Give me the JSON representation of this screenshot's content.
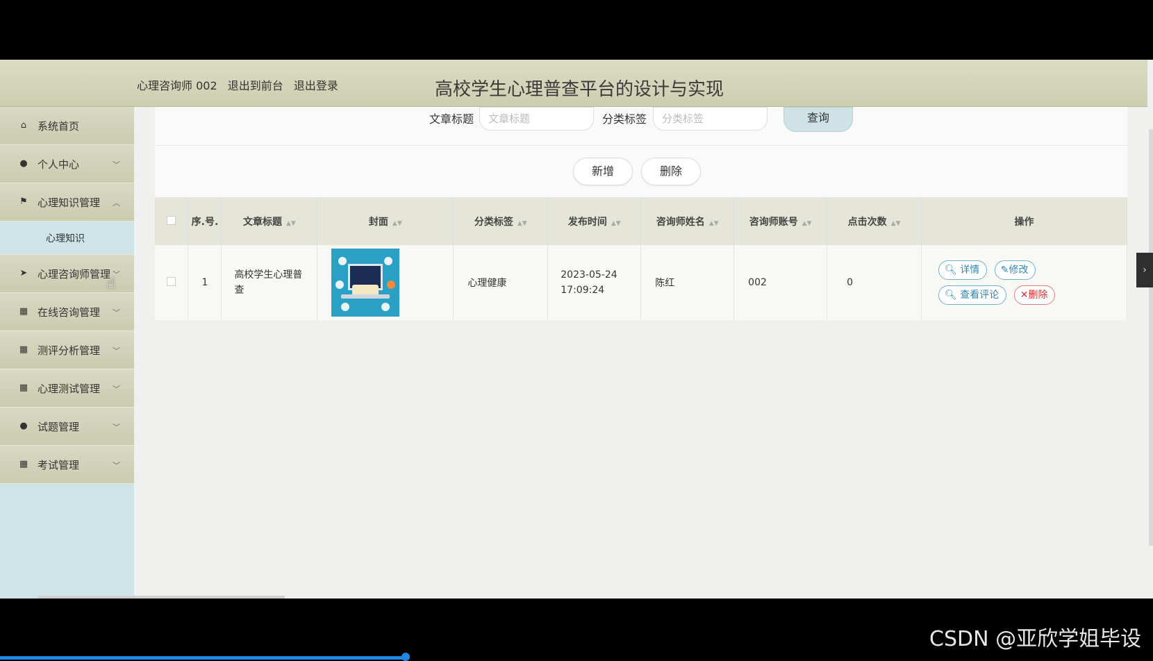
{
  "header": {
    "user_label": "心理咨询师 002",
    "back_link": "退出到前台",
    "logout_link": "退出登录",
    "title": "高校学生心理普查平台的设计与实现"
  },
  "sidebar": {
    "items": [
      {
        "label": "系统首页",
        "icon": "home-icon"
      },
      {
        "label": "个人中心",
        "icon": "user-icon"
      },
      {
        "label": "心理知识管理",
        "icon": "flag-icon",
        "submenu": "心理知识"
      },
      {
        "label": "心理咨询师管理",
        "icon": "send-icon"
      },
      {
        "label": "在线咨询管理",
        "icon": "grid-icon"
      },
      {
        "label": "测评分析管理",
        "icon": "grid-icon"
      },
      {
        "label": "心理测试管理",
        "icon": "grid-icon"
      },
      {
        "label": "试题管理",
        "icon": "bulb-icon"
      },
      {
        "label": "考试管理",
        "icon": "grid-icon"
      }
    ]
  },
  "search": {
    "title_label": "文章标题",
    "title_placeholder": "文章标题",
    "category_label": "分类标签",
    "category_placeholder": "分类标签",
    "query_button": "查询"
  },
  "actions": {
    "add": "新增",
    "delete": "删除"
  },
  "table": {
    "headers": [
      "序.号.",
      "文章标题",
      "封面",
      "分类标签",
      "发布时间",
      "咨询师姓名",
      "咨询师账号",
      "点击次数",
      "操作"
    ],
    "rows": [
      {
        "index": "1",
        "title": "高校学生心理普查",
        "category": "心理健康",
        "time": "2023-05-24 17:09:24",
        "counselor_name": "陈红",
        "counselor_account": "002",
        "clicks": "0"
      }
    ],
    "ops": {
      "detail": "详情",
      "edit": "修改",
      "comments": "查看评论",
      "delete": "删除"
    }
  },
  "watermark": "CSDN @亚欣学姐毕设",
  "colors": {
    "header_bg": "#d6d6bd",
    "sidebar_item_bg": "#d2d2b8",
    "submenu_bg": "#cfe4e8",
    "op_blue": "#2f87b3",
    "op_red": "#d33333"
  }
}
